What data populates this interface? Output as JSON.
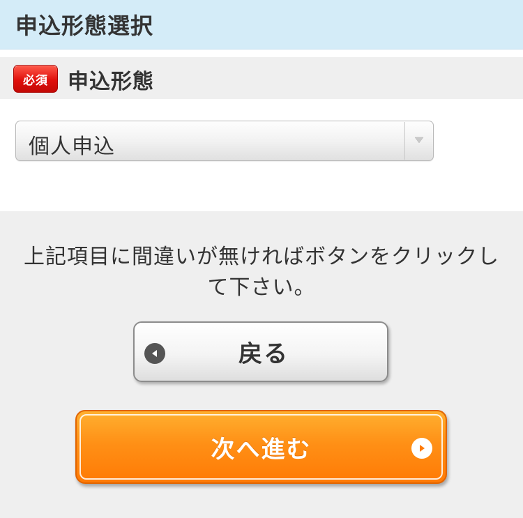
{
  "header": {
    "title": "申込形態選択"
  },
  "field": {
    "required_badge": "必須",
    "label": "申込形態",
    "select": {
      "selected_value": "個人申込",
      "arrow_icon": "chevron-down-icon"
    }
  },
  "instruction": {
    "line1": "上記項目に間違いが無ければボタンをクリックし",
    "line2": "て下さい。"
  },
  "buttons": {
    "back": {
      "label": "戻る",
      "icon": "play-left-icon"
    },
    "next": {
      "label": "次へ進む",
      "icon": "play-right-icon"
    }
  },
  "colors": {
    "header_bg": "#d4ecf8",
    "required_badge": "#e0100c",
    "next_button": "#ff8a0c",
    "page_bg": "#efefef"
  }
}
